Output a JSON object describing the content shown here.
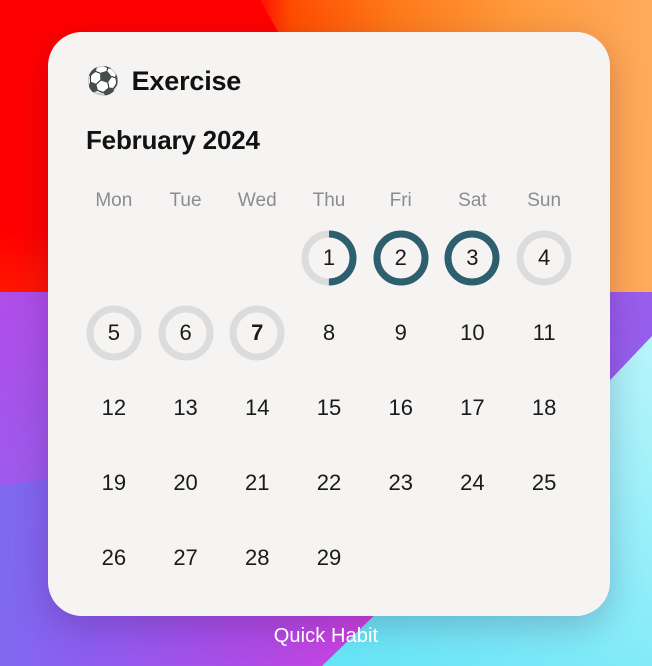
{
  "app": {
    "footer_label": "Quick Habit",
    "footer_color": "#ffffff"
  },
  "card": {
    "background": "#f5f4f2",
    "habit": {
      "icon": "soccer-ball-emoji",
      "emoji": "⚽",
      "name": "Exercise"
    },
    "month_label": "February 2024",
    "weekday_headers": [
      "Mon",
      "Tue",
      "Wed",
      "Thu",
      "Fri",
      "Sat",
      "Sun"
    ],
    "colors": {
      "progress_filled": "#2e5f6e",
      "progress_track": "#dcdcdc",
      "day_text": "#1a1a1a",
      "weekday_text": "#8c8c90"
    },
    "leading_blanks": 3,
    "days": [
      {
        "date": "1",
        "progress": 0.5,
        "ring": true,
        "today": false
      },
      {
        "date": "2",
        "progress": 1.0,
        "ring": true,
        "today": false
      },
      {
        "date": "3",
        "progress": 1.0,
        "ring": true,
        "today": false
      },
      {
        "date": "4",
        "progress": 0.0,
        "ring": true,
        "today": false
      },
      {
        "date": "5",
        "progress": 0.0,
        "ring": true,
        "today": false
      },
      {
        "date": "6",
        "progress": 0.0,
        "ring": true,
        "today": false
      },
      {
        "date": "7",
        "progress": 0.0,
        "ring": true,
        "today": true
      },
      {
        "date": "8",
        "progress": null,
        "ring": false,
        "today": false
      },
      {
        "date": "9",
        "progress": null,
        "ring": false,
        "today": false
      },
      {
        "date": "10",
        "progress": null,
        "ring": false,
        "today": false
      },
      {
        "date": "11",
        "progress": null,
        "ring": false,
        "today": false
      },
      {
        "date": "12",
        "progress": null,
        "ring": false,
        "today": false
      },
      {
        "date": "13",
        "progress": null,
        "ring": false,
        "today": false
      },
      {
        "date": "14",
        "progress": null,
        "ring": false,
        "today": false
      },
      {
        "date": "15",
        "progress": null,
        "ring": false,
        "today": false
      },
      {
        "date": "16",
        "progress": null,
        "ring": false,
        "today": false
      },
      {
        "date": "17",
        "progress": null,
        "ring": false,
        "today": false
      },
      {
        "date": "18",
        "progress": null,
        "ring": false,
        "today": false
      },
      {
        "date": "19",
        "progress": null,
        "ring": false,
        "today": false
      },
      {
        "date": "20",
        "progress": null,
        "ring": false,
        "today": false
      },
      {
        "date": "21",
        "progress": null,
        "ring": false,
        "today": false
      },
      {
        "date": "22",
        "progress": null,
        "ring": false,
        "today": false
      },
      {
        "date": "23",
        "progress": null,
        "ring": false,
        "today": false
      },
      {
        "date": "24",
        "progress": null,
        "ring": false,
        "today": false
      },
      {
        "date": "25",
        "progress": null,
        "ring": false,
        "today": false
      },
      {
        "date": "26",
        "progress": null,
        "ring": false,
        "today": false
      },
      {
        "date": "27",
        "progress": null,
        "ring": false,
        "today": false
      },
      {
        "date": "28",
        "progress": null,
        "ring": false,
        "today": false
      },
      {
        "date": "29",
        "progress": null,
        "ring": false,
        "today": false
      }
    ]
  }
}
